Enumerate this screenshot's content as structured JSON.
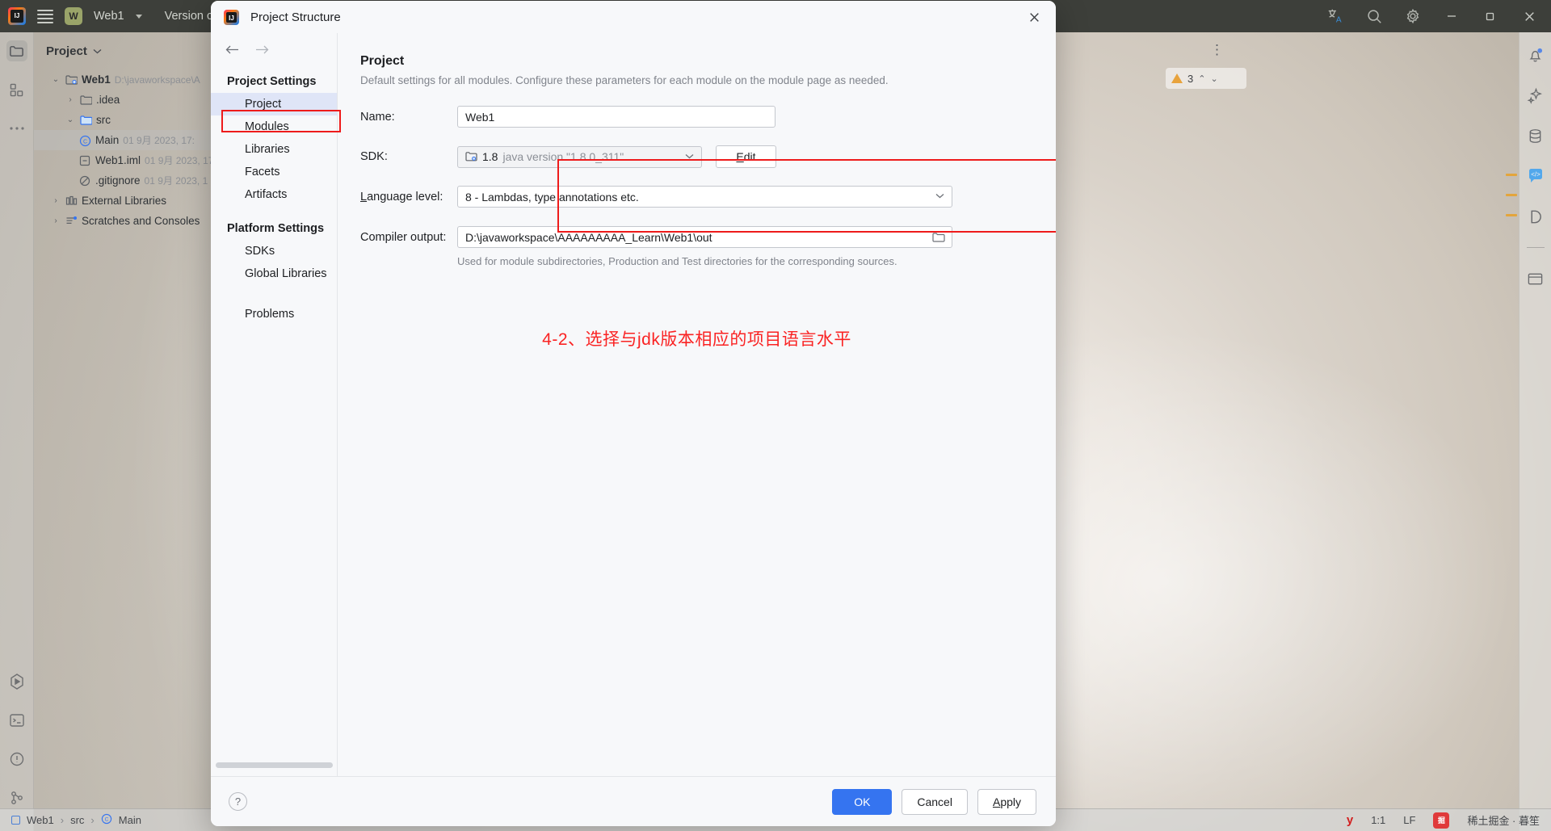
{
  "titlebar": {
    "logo_icon": "intellij-idea-logo",
    "menu_icon": "hamburger-menu-icon",
    "project_badge": "W",
    "project_name": "Web1",
    "vcs_label": "Version con",
    "translate_icon": "translate-icon",
    "search_icon": "search-icon",
    "settings_icon": "gear-icon",
    "minimize_icon": "minimize-icon",
    "maximize_icon": "maximize-icon",
    "close_icon": "close-icon"
  },
  "activity_bar": {
    "items": [
      {
        "icon": "project-folder-icon",
        "selected": true
      },
      {
        "icon": "structure-icon",
        "selected": false
      },
      {
        "icon": "more-ellipsis-icon",
        "selected": false
      }
    ],
    "bottom_items": [
      {
        "icon": "run-icon"
      },
      {
        "icon": "terminal-icon"
      },
      {
        "icon": "problems-icon"
      },
      {
        "icon": "version-control-icon"
      }
    ]
  },
  "project_panel": {
    "title": "Project",
    "chevron_icon": "chevron-down-icon",
    "tree": [
      {
        "indent": 0,
        "arrow": "v",
        "icon": "module-folder-icon",
        "label": "Web1",
        "bold": true,
        "meta": "D:\\javaworkspace\\A",
        "selected": false
      },
      {
        "indent": 1,
        "arrow": ">",
        "icon": "folder-icon",
        "label": ".idea",
        "bold": false,
        "meta": "",
        "selected": false
      },
      {
        "indent": 1,
        "arrow": "v",
        "icon": "source-folder-icon",
        "label": "src",
        "bold": false,
        "meta": "",
        "selected": false
      },
      {
        "indent": 2,
        "arrow": "",
        "icon": "java-class-icon",
        "label": "Main",
        "bold": false,
        "meta": "01 9月 2023, 17:",
        "selected": true
      },
      {
        "indent": 2,
        "arrow": "",
        "icon": "iml-file-icon",
        "label": "Web1.iml",
        "bold": false,
        "meta": "01 9月 2023, 17",
        "selected": false
      },
      {
        "indent": 2,
        "arrow": "",
        "icon": "gitignore-icon",
        "label": ".gitignore",
        "bold": false,
        "meta": "01 9月 2023, 1",
        "selected": false
      },
      {
        "indent": 0,
        "arrow": ">",
        "icon": "external-libraries-icon",
        "label": "External Libraries",
        "bold": false,
        "meta": "",
        "selected": false
      },
      {
        "indent": 0,
        "arrow": ">",
        "icon": "scratches-icon",
        "label": "Scratches and Consoles",
        "bold": false,
        "meta": "",
        "selected": false
      }
    ]
  },
  "editor_overlay": {
    "kebab_icon": "more-vertical-icon",
    "warning_icon": "warning-triangle-icon",
    "warning_count": "3",
    "prev_icon": "chevron-up-icon",
    "next_icon": "chevron-down-icon"
  },
  "right_strip": {
    "items": [
      {
        "icon": "notifications-bell-icon"
      },
      {
        "icon": "ai-assistant-sparkle-icon"
      },
      {
        "icon": "database-icon"
      },
      {
        "icon": "code-with-me-icon"
      },
      {
        "icon": "docs-letter-d-icon"
      },
      {
        "icon": "panel-icon"
      }
    ]
  },
  "status_bar": {
    "breadcrumb": [
      {
        "icon": "module-icon",
        "label": "Web1"
      },
      {
        "icon": "",
        "label": "src"
      },
      {
        "icon": "java-class-icon",
        "label": "Main"
      }
    ],
    "separator": "›",
    "caret_position": "1:1",
    "line_separator": "LF",
    "ime_marker": "y",
    "watermark": "稀土掘金 · 暮笙"
  },
  "dialog": {
    "logo_icon": "intellij-idea-logo",
    "title": "Project Structure",
    "close_icon": "close-icon",
    "nav": {
      "back_icon": "arrow-left-icon",
      "forward_icon": "arrow-right-icon",
      "groups": [
        {
          "title": "Project Settings",
          "items": [
            {
              "label": "Project",
              "active": true
            },
            {
              "label": "Modules",
              "active": false
            },
            {
              "label": "Libraries",
              "active": false
            },
            {
              "label": "Facets",
              "active": false
            },
            {
              "label": "Artifacts",
              "active": false
            }
          ]
        },
        {
          "title": "Platform Settings",
          "items": [
            {
              "label": "SDKs",
              "active": false
            },
            {
              "label": "Global Libraries",
              "active": false
            }
          ]
        }
      ],
      "standalone": [
        {
          "label": "Problems",
          "active": false
        }
      ]
    },
    "content": {
      "heading": "Project",
      "description": "Default settings for all modules. Configure these parameters for each module on the module page as needed.",
      "name_label": "Name:",
      "name_value": "Web1",
      "sdk_label": "SDK:",
      "sdk_icon": "jdk-module-icon",
      "sdk_version": "1.8",
      "sdk_description": "java version \"1.8.0_311\"",
      "sdk_dropdown_icon": "chevron-down-icon",
      "edit_button": "Edit",
      "edit_mnemonic": "E",
      "language_level_label_prefix": "L",
      "language_level_label": "anguage level:",
      "language_level_value": "8 - Lambdas, type annotations etc.",
      "language_dropdown_icon": "chevron-down-icon",
      "compiler_output_label": "Compiler output:",
      "compiler_output_value": "D:\\javaworkspace\\AAAAAAAAA_Learn\\Web1\\out",
      "browse_icon": "folder-browse-icon",
      "compiler_output_hint": "Used for module subdirectories, Production and Test directories for the corresponding sources.",
      "annotation": "4-2、选择与jdk版本相应的项目语言水平",
      "annotation_color": "#fa2323",
      "highlight_color": "#ee1b1b"
    },
    "footer": {
      "help_icon": "help-question-icon",
      "ok_label": "OK",
      "cancel_label": "Cancel",
      "apply_label": "Apply",
      "apply_mnemonic": "A",
      "primary_color": "#3574f0"
    }
  }
}
